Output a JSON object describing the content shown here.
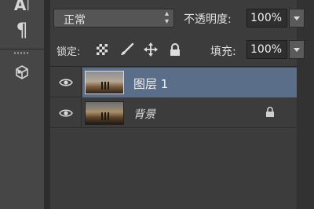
{
  "toolbar": {
    "tools": [
      {
        "name": "character-panel",
        "icon": "A|"
      },
      {
        "name": "paragraph-panel",
        "icon": "¶"
      },
      {
        "name": "3d-panel",
        "icon": "cube"
      }
    ]
  },
  "layers_panel": {
    "blend_mode": "正常",
    "opacity_label": "不透明度:",
    "opacity_value": "100%",
    "lock_label": "锁定:",
    "lock_icons": [
      "transparency-lock-icon",
      "brush-lock-icon",
      "move-lock-icon",
      "padlock-icon"
    ],
    "fill_label": "填充:",
    "fill_value": "100%",
    "layers": [
      {
        "name": "图层 1",
        "visible": true,
        "selected": true,
        "locked": false
      },
      {
        "name": "背景",
        "visible": true,
        "selected": false,
        "locked": true
      }
    ]
  },
  "colors": {
    "panel_bg": "#3c3c3c",
    "selected_layer": "#5a6e8a",
    "toolbar_bg": "#464646"
  }
}
